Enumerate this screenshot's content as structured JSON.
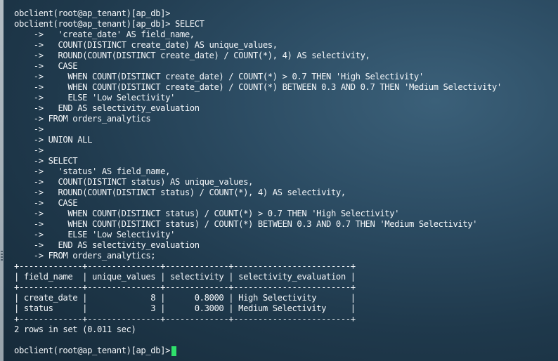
{
  "terminal": {
    "lines": [
      "obclient(root@ap_tenant)[ap_db]>",
      "obclient(root@ap_tenant)[ap_db]> SELECT",
      "    ->   'create_date' AS field_name,",
      "    ->   COUNT(DISTINCT create_date) AS unique_values,",
      "    ->   ROUND(COUNT(DISTINCT create_date) / COUNT(*), 4) AS selectivity,",
      "    ->   CASE",
      "    ->     WHEN COUNT(DISTINCT create_date) / COUNT(*) > 0.7 THEN 'High Selectivity'",
      "    ->     WHEN COUNT(DISTINCT create_date) / COUNT(*) BETWEEN 0.3 AND 0.7 THEN 'Medium Selectivity'",
      "    ->     ELSE 'Low Selectivity'",
      "    ->   END AS selectivity_evaluation",
      "    -> FROM orders_analytics",
      "    ->",
      "    -> UNION ALL",
      "    ->",
      "    -> SELECT",
      "    ->   'status' AS field_name,",
      "    ->   COUNT(DISTINCT status) AS unique_values,",
      "    ->   ROUND(COUNT(DISTINCT status) / COUNT(*), 4) AS selectivity,",
      "    ->   CASE",
      "    ->     WHEN COUNT(DISTINCT status) / COUNT(*) > 0.7 THEN 'High Selectivity'",
      "    ->     WHEN COUNT(DISTINCT status) / COUNT(*) BETWEEN 0.3 AND 0.7 THEN 'Medium Selectivity'",
      "    ->     ELSE 'Low Selectivity'",
      "    ->   END AS selectivity_evaluation",
      "    -> FROM orders_analytics;",
      "+-------------+---------------+-------------+------------------------+",
      "| field_name  | unique_values | selectivity | selectivity_evaluation |",
      "+-------------+---------------+-------------+------------------------+",
      "| create_date |             8 |      0.8000 | High Selectivity       |",
      "| status      |             3 |      0.3000 | Medium Selectivity     |",
      "+-------------+---------------+-------------+------------------------+",
      "2 rows in set (0.011 sec)",
      ""
    ],
    "prompt": "obclient(root@ap_tenant)[ap_db]>",
    "cursor_color": "#2fe06b"
  }
}
